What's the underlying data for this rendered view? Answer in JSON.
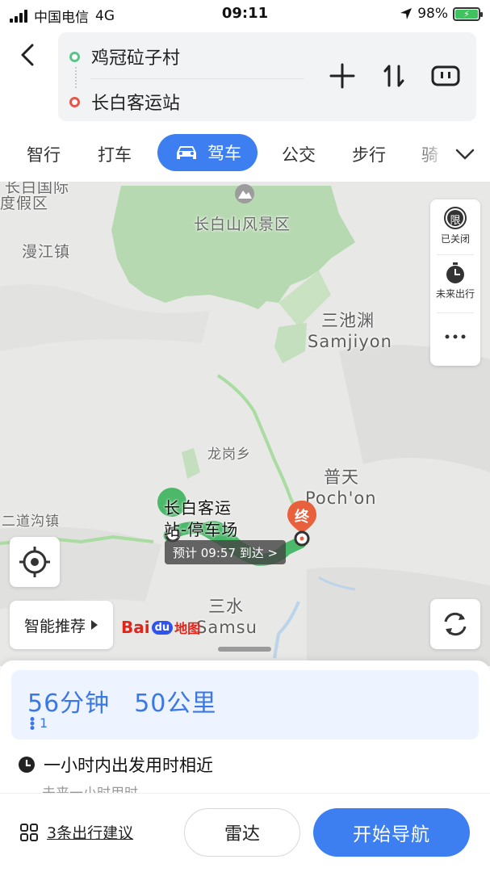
{
  "status_bar": {
    "carrier": "中国电信",
    "network": "4G",
    "time": "09:11",
    "battery": "98%"
  },
  "route": {
    "origin": "鸡冠砬子村",
    "destination": "长白客运站"
  },
  "tabs": {
    "items": [
      "智行",
      "打车",
      "驾车",
      "公交",
      "步行",
      "骑"
    ],
    "active": "驾车"
  },
  "map": {
    "labels": {
      "changbaishan": "长白山风景区",
      "manjiang": "漫江镇",
      "jiaqu": "度假区",
      "jiaqu_top": "长白国际",
      "sanchiyuan_cn": "三池渊",
      "sanchiyuan_en": "Samjiyon",
      "longgang": "龙岗乡",
      "putian_cn": "普天",
      "putian_en": "Poch'on",
      "erdao": "二道沟镇",
      "sanshui_cn": "三水",
      "sanshui_en": "Samsu",
      "dest_line1": "长白客运",
      "dest_line2": "站-停车场"
    },
    "side_panel": {
      "limit_icon_text": "限",
      "limit_label": "已关闭",
      "future_label": "未来出行"
    },
    "eta": "预计 09:57 到达 >",
    "end_marker": "终",
    "smart_recommend": "智能推荐",
    "logo": {
      "bai": "Bai",
      "du": "du",
      "ditu": "地图"
    }
  },
  "summary": {
    "duration": "56分钟",
    "distance": "50公里",
    "traffic_lights": "1"
  },
  "tip": {
    "title": "一小时内出发用时相近",
    "subtitle": "未来一小时用时"
  },
  "bottom": {
    "suggestions": "3条出行建议",
    "radar": "雷达",
    "navigate": "开始导航"
  },
  "colors": {
    "accent": "#3d7ff0",
    "route_green": "#4cb86a",
    "origin_dot": "#5cc389",
    "dest_dot": "#e4574b",
    "end_marker": "#e8603c"
  }
}
